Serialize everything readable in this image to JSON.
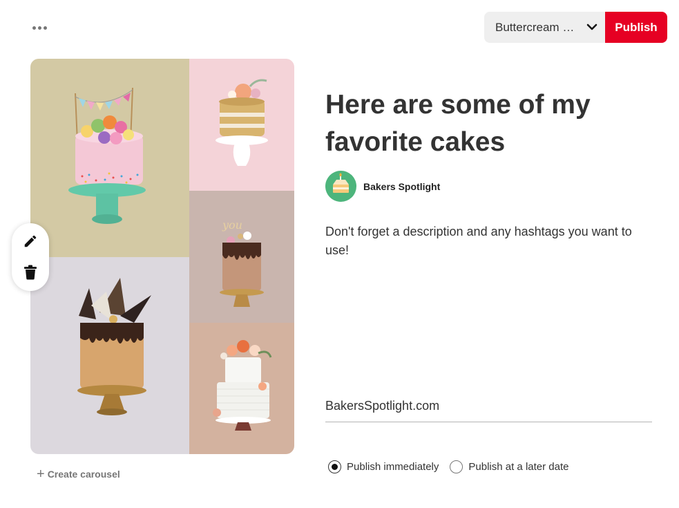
{
  "toolbar": {
    "more_icon": "more-horizontal-icon",
    "board_select": "Buttercream C...",
    "publish_label": "Publish",
    "accent_color": "#e60023"
  },
  "pin": {
    "images": [
      "cake-rainbow-macarons",
      "cake-golden-naked",
      "cake-chocolate-drip",
      "cake-chocolate-shards",
      "cake-white-floral"
    ],
    "edit_icons": [
      "pencil-icon",
      "trash-icon"
    ],
    "create_carousel": "Create carousel"
  },
  "details": {
    "title": "Here are some of my favorite cakes",
    "author": "Bakers Spotlight",
    "description": "Don't forget a description and any hashtags you want to use!",
    "link": "BakersSpotlight.com"
  },
  "publish_options": {
    "immediately": "Publish immediately",
    "later": "Publish at a later date",
    "selected": "immediately"
  }
}
